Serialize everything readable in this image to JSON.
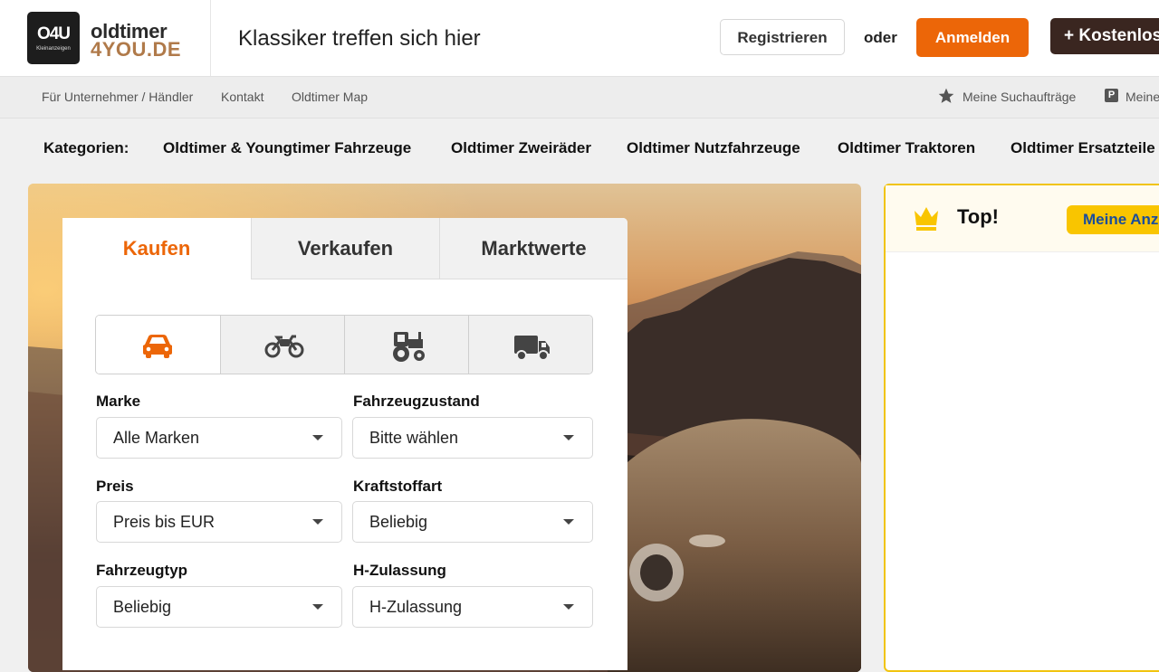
{
  "header": {
    "logo_mark": "O4U",
    "logo_small": "Kleinanzeigen",
    "logo_line1": "oldtimer",
    "logo_line2": "4YOU.DE",
    "tagline": "Klassiker treffen sich hier",
    "register_label": "Registrieren",
    "or_label": "oder",
    "login_label": "Anmelden",
    "free_ad_label": "+ Kostenlos"
  },
  "subnav": {
    "links": [
      "Für Unternehmer / Händler",
      "Kontakt",
      "Oldtimer Map"
    ],
    "saved_searches": "Meine Suchaufträge",
    "my_ads": "Meine"
  },
  "categories": {
    "label": "Kategorien:",
    "items": [
      "Oldtimer & Youngtimer Fahrzeuge",
      "Oldtimer Zweiräder",
      "Oldtimer Nutzfahrzeuge",
      "Oldtimer Traktoren",
      "Oldtimer Ersatzteile"
    ]
  },
  "search": {
    "tabs": [
      "Kaufen",
      "Verkaufen",
      "Marktwerte"
    ],
    "vehicle_types": [
      "car-icon",
      "motorcycle-icon",
      "tractor-icon",
      "truck-icon"
    ],
    "fields": [
      {
        "label": "Marke",
        "value": "Alle Marken"
      },
      {
        "label": "Fahrzeugzustand",
        "value": "Bitte wählen"
      },
      {
        "label": "Preis",
        "value": "Preis bis EUR"
      },
      {
        "label": "Kraftstoffart",
        "value": "Beliebig"
      },
      {
        "label": "Fahrzeugtyp",
        "value": "Beliebig"
      },
      {
        "label": "H-Zulassung",
        "value": "H-Zulassung"
      }
    ]
  },
  "top": {
    "title": "Top!",
    "button_label": "Meine Anz"
  },
  "colors": {
    "accent": "#ec6608",
    "dark_brand": "#3a2620",
    "top_border": "#f1c40f",
    "top_button": "#f9c500"
  }
}
